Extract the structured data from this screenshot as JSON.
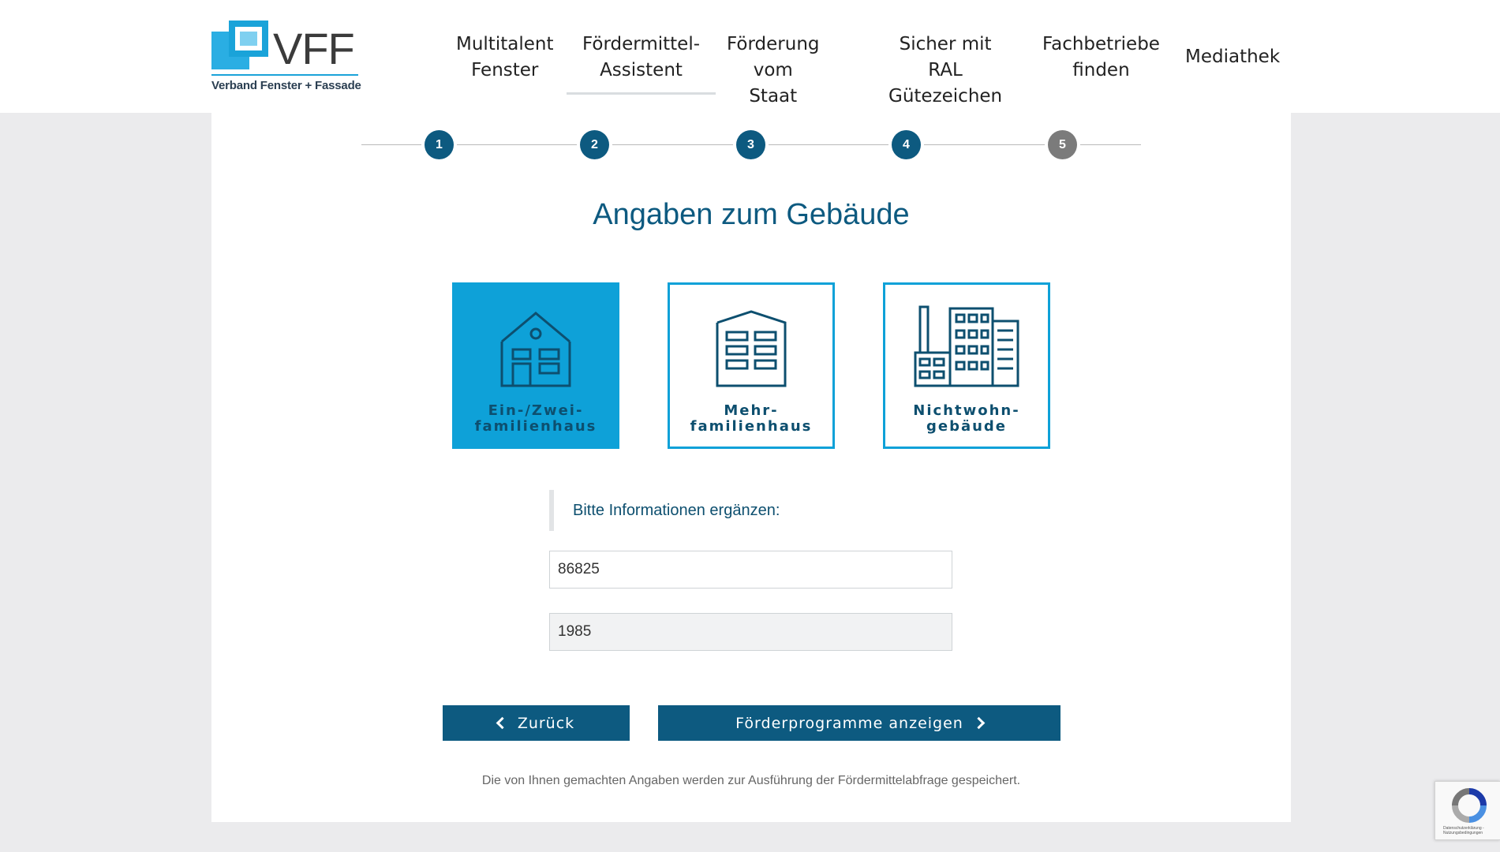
{
  "brand": {
    "logo_text": "VFF",
    "logo_sub": "Verband Fenster + Fassade",
    "colors": {
      "primary": "#0d5a80",
      "accent": "#0ea1d8"
    }
  },
  "nav": {
    "items": [
      {
        "label": "Multitalent\nFenster"
      },
      {
        "label": "Fördermittel-\nAssistent",
        "active": true
      },
      {
        "label": "Förderung vom\nStaat"
      },
      {
        "label": "Sicher mit RAL\nGütezeichen"
      },
      {
        "label": "Fachbetriebe\nfinden"
      },
      {
        "label": "Mediathek"
      }
    ]
  },
  "steps": [
    "1",
    "2",
    "3",
    "4",
    "5"
  ],
  "current_step": 4,
  "title": "Angaben zum Gebäude",
  "building_types": [
    {
      "label_line1": "Ein-/Zwei-",
      "label_line2": "familienhaus",
      "icon": "single-family-house-icon",
      "selected": true
    },
    {
      "label_line1": "Mehr-",
      "label_line2": "familienhaus",
      "icon": "apartment-building-icon",
      "selected": false
    },
    {
      "label_line1": "Nichtwohn-",
      "label_line2": "gebäude",
      "icon": "factory-building-icon",
      "selected": false
    }
  ],
  "info_heading": "Bitte Informationen ergänzen:",
  "fields": {
    "postal_code": "86825",
    "construction_year": "1985"
  },
  "buttons": {
    "back": "Zurück",
    "next": "Förderprogramme anzeigen"
  },
  "note": "Die von Ihnen gemachten Angaben werden zur Ausführung der Fördermittelabfrage gespeichert.",
  "recaptcha": {
    "icon": "recaptcha-icon",
    "small_text": "Datenschutzerklärung - Nutzungsbedingungen"
  }
}
